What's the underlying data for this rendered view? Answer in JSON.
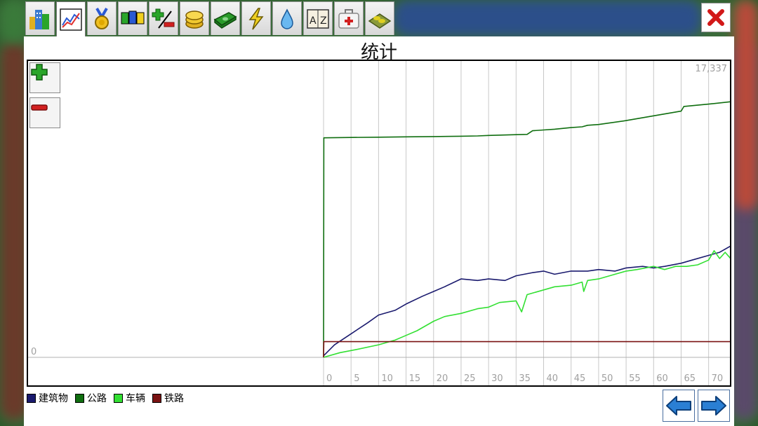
{
  "title": "统计",
  "tabs": [
    {
      "icon": "city-buildings-icon"
    },
    {
      "icon": "line-chart-icon",
      "active": true
    },
    {
      "icon": "medal-icon"
    },
    {
      "icon": "bar-blocks-icon"
    },
    {
      "icon": "plus-minus-icon"
    },
    {
      "icon": "coins-icon"
    },
    {
      "icon": "money-stack-icon"
    },
    {
      "icon": "lightning-icon"
    },
    {
      "icon": "water-drop-icon"
    },
    {
      "icon": "az-book-icon"
    },
    {
      "icon": "medical-kit-icon"
    },
    {
      "icon": "farm-field-icon"
    }
  ],
  "colors": {
    "buildings": "#1a1a6e",
    "roads": "#0f6e0f",
    "vehicles": "#33e033",
    "rails": "#7a1212",
    "accent_blue": "#2a7fd4",
    "close_red": "#d21818"
  },
  "chart_data": {
    "type": "line",
    "y_max_label": "17,337",
    "y_min_label": "0",
    "ylim": [
      0,
      17337
    ],
    "xlim": [
      0,
      74
    ],
    "x_ticks": [
      "0",
      "5",
      "10",
      "15",
      "20",
      "25",
      "30",
      "35",
      "40",
      "45",
      "50",
      "55",
      "60",
      "65",
      "70"
    ],
    "grid": "vertical",
    "legend_position": "bottom-left",
    "series": [
      {
        "name": "建筑物",
        "color": "#1a1a6e",
        "x": [
          0,
          2,
          5,
          8,
          10,
          13,
          15,
          18,
          20,
          22,
          25,
          28,
          30,
          33,
          35,
          38,
          40,
          42,
          45,
          48,
          50,
          53,
          55,
          58,
          60,
          62,
          65,
          67,
          70,
          72,
          74
        ],
        "y": [
          100,
          800,
          1500,
          2200,
          2700,
          3000,
          3400,
          3900,
          4200,
          4500,
          5000,
          4900,
          5000,
          4900,
          5200,
          5400,
          5500,
          5300,
          5500,
          5500,
          5600,
          5500,
          5700,
          5800,
          5700,
          5800,
          6000,
          6200,
          6500,
          6700,
          7100
        ]
      },
      {
        "name": "公路",
        "color": "#0f6e0f",
        "x": [
          0,
          0.05,
          5,
          10,
          15,
          20,
          25,
          28,
          30,
          35,
          37,
          38,
          40,
          42,
          45,
          47,
          48,
          50,
          55,
          60,
          65,
          65.5,
          70,
          74
        ],
        "y": [
          0,
          14000,
          14020,
          14040,
          14060,
          14080,
          14100,
          14120,
          14150,
          14200,
          14220,
          14450,
          14500,
          14550,
          14650,
          14700,
          14800,
          14850,
          15100,
          15400,
          15700,
          16000,
          16150,
          16300
        ]
      },
      {
        "name": "车辆",
        "color": "#33e033",
        "x": [
          0,
          3,
          6,
          10,
          13,
          15,
          17,
          20,
          22,
          25,
          28,
          30,
          32,
          35,
          36,
          37,
          40,
          42,
          45,
          47,
          47.3,
          48,
          50,
          53,
          55,
          57,
          60,
          62,
          64,
          66,
          68,
          70,
          71,
          72,
          73,
          74
        ],
        "y": [
          0,
          300,
          500,
          800,
          1100,
          1400,
          1700,
          2300,
          2600,
          2800,
          3100,
          3200,
          3500,
          3600,
          2900,
          4000,
          4300,
          4500,
          4600,
          4800,
          4200,
          4900,
          5000,
          5300,
          5500,
          5600,
          5800,
          5600,
          5800,
          5800,
          5900,
          6200,
          6800,
          6300,
          6700,
          6300
        ]
      },
      {
        "name": "铁路",
        "color": "#7a1212",
        "x": [
          0,
          0.05,
          74
        ],
        "y": [
          0,
          1000,
          1000
        ]
      }
    ]
  },
  "legend": [
    {
      "label": "建筑物",
      "color": "#1a1a6e"
    },
    {
      "label": "公路",
      "color": "#0f6e0f"
    },
    {
      "label": "车辆",
      "color": "#33e033"
    },
    {
      "label": "铁路",
      "color": "#7a1212"
    }
  ]
}
